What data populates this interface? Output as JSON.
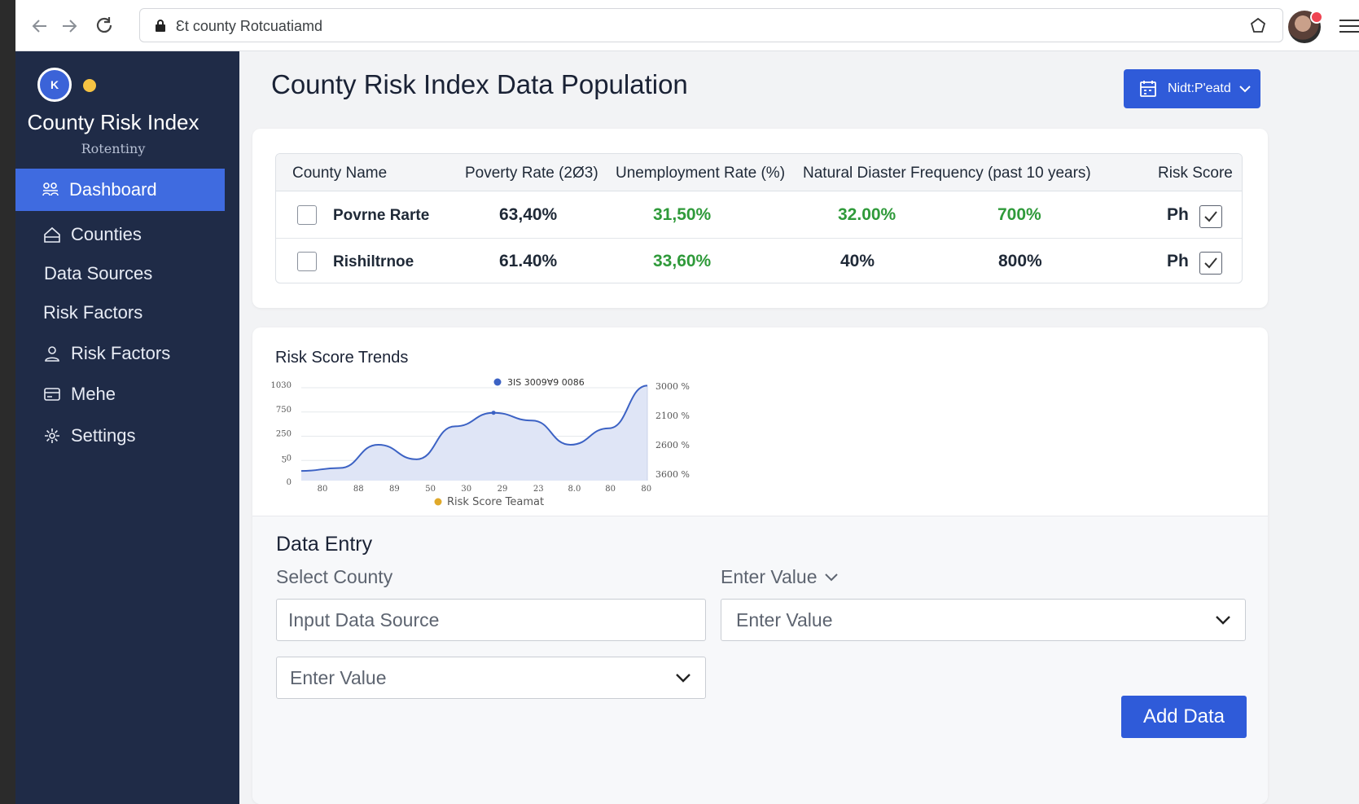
{
  "browser": {
    "url": "Ɛt county Rotcuatiamd"
  },
  "sidebar": {
    "logo_letter": "K",
    "title": "County Risk Index",
    "subtitle": "Rotentiny",
    "items": [
      {
        "label": "Dashboard",
        "icon": "dashboard-icon",
        "active": true
      },
      {
        "label": "Counties",
        "icon": "house-icon",
        "active": false
      },
      {
        "label": "Data Sources",
        "icon": "",
        "active": false
      },
      {
        "label": "Risk Factors",
        "icon": "",
        "active": false
      },
      {
        "label": "Risk Factors",
        "icon": "user-icon",
        "active": false
      },
      {
        "label": "Mehe",
        "icon": "card-icon",
        "active": false
      },
      {
        "label": "Settings",
        "icon": "gear-icon",
        "active": false
      }
    ]
  },
  "header": {
    "title": "County Risk Index Data Population",
    "select_label": "Nidt:P'eatd"
  },
  "table": {
    "columns": [
      "County Name",
      "Poverty Rate (2Ø3)",
      "Unemployment Rate (%)",
      "Natural Diaster Frequency (past 10 years)",
      "Risk Score"
    ],
    "rows": [
      {
        "name": "Povrne Rarte",
        "poverty": "63,40%",
        "unemployment": "31,50%",
        "disaster": "32.00%",
        "extra": "700%",
        "score": "Ph",
        "checked": false,
        "score_checked": true
      },
      {
        "name": "Rishiltrnoe",
        "poverty": "61.40%",
        "unemployment": "33,60%",
        "disaster": "40%",
        "extra": "800%",
        "score": "Ph",
        "checked": false,
        "score_checked": true
      }
    ],
    "colors": {
      "green": "#2f9a3a"
    }
  },
  "chart_data": {
    "type": "area",
    "title": "Risk Score Trends",
    "legend_top": "3IS 3009Ɐ9 0086",
    "legend_bottom": "Risk Score Teamat",
    "x": [
      "80",
      "88",
      "89",
      "50",
      "30",
      "29",
      "23",
      "8.0",
      "80",
      "80"
    ],
    "y_left_ticks": [
      "1030",
      "750",
      "250",
      "ƽ0",
      "0"
    ],
    "y_right_ticks": [
      "3000 %",
      "2100 %",
      "2600 %",
      "3600 %"
    ],
    "ylim": [
      0,
      1000
    ],
    "series": [
      {
        "values": [
          100,
          130,
          370,
          220,
          560,
          700,
          620,
          370,
          540,
          980
        ]
      }
    ],
    "colors": {
      "line": "#3c62c4",
      "fill": "#dfe5f6",
      "legend_top": "#3c62c4",
      "legend_bottom": "#e0a92a"
    }
  },
  "entry": {
    "title": "Data Entry",
    "select_county_label": "Select County",
    "enter_value_label": "Enter Valuе",
    "input_placeholder": "Input Data Source",
    "value_select_left": "Enter Value",
    "value_select_right": "Enter Value",
    "add_button": "Add Data"
  },
  "colors": {
    "accent": "#2f5bd9",
    "sidebar_bg": "#1f2b47",
    "sidebar_active": "#3f6be0"
  }
}
